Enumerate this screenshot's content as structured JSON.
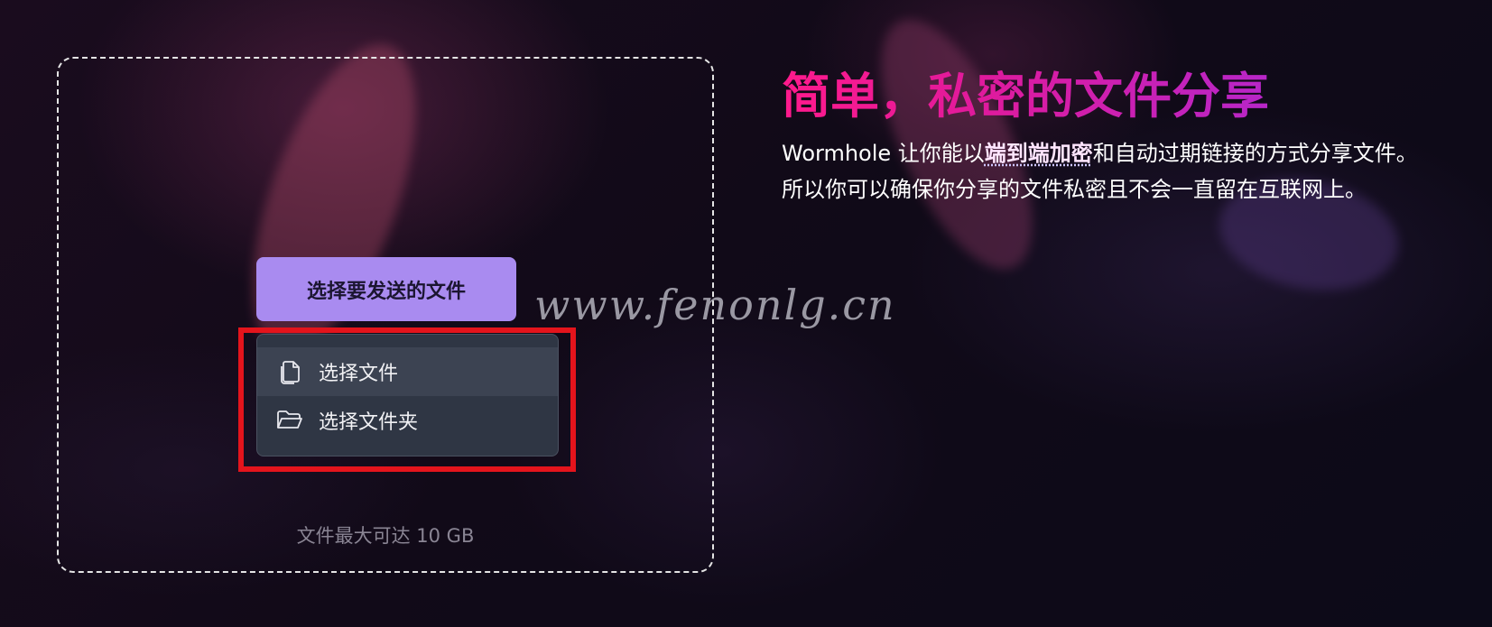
{
  "dropzone": {
    "send_button_label": "选择要发送的文件",
    "limit_text": "文件最大可达 10 GB"
  },
  "menu": {
    "items": [
      {
        "label": "选择文件",
        "icon": "files-icon"
      },
      {
        "label": "选择文件夹",
        "icon": "folder-open-icon"
      }
    ]
  },
  "hero": {
    "title": "简单，私密的文件分享",
    "desc_prefix": "Wormhole 让你能以",
    "desc_emphasis": "端到端加密",
    "desc_suffix": "和自动过期链接的方式分享文件。 所以你可以确保你分享的文件私密且不会一直留在互联网上。"
  },
  "watermark": "www.fenonlg.cn",
  "colors": {
    "button_bg": "#a98bf0",
    "menu_bg": "#2f3644",
    "highlight": "#e4141c",
    "title_gradient_start": "#ff1a8c",
    "title_gradient_end": "#b726c8"
  }
}
